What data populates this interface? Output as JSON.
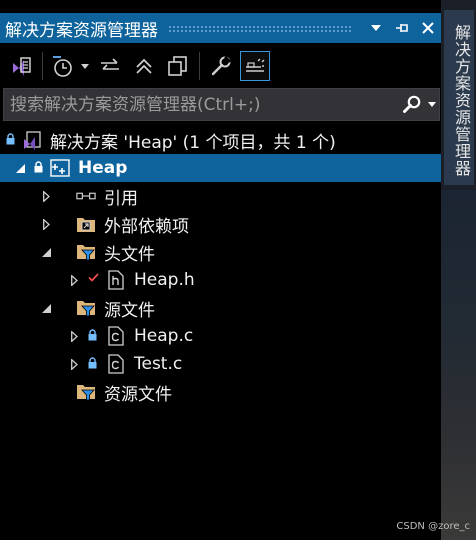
{
  "panel": {
    "title": "解决方案资源管理器",
    "controls": [
      "▾",
      "⊣",
      "✕"
    ]
  },
  "search": {
    "placeholder": "搜索解决方案资源管理器(Ctrl+;)"
  },
  "tree": {
    "solution": "解决方案 'Heap' (1 个项目，共 1 个)",
    "project": "Heap",
    "references": "引用",
    "external_deps": "外部依赖项",
    "header_files": "头文件",
    "heap_h": "Heap.h",
    "source_files": "源文件",
    "heap_c": "Heap.c",
    "test_c": "Test.c",
    "resource_files": "资源文件"
  },
  "side_tab": {
    "label": "解决方案资源管理器"
  },
  "watermark": "CSDN @zore_c",
  "colors": {
    "accent": "#0e639c",
    "background": "#000000",
    "folder": "#dcb67a",
    "lock": "#75beff",
    "check": "#f14c4c"
  }
}
